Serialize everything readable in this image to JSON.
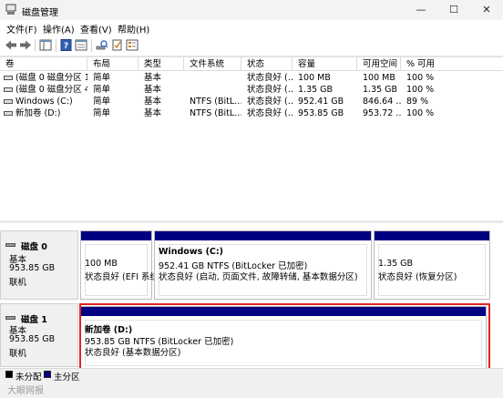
{
  "window": {
    "title": "磁盘管理",
    "controls": {
      "minimize": "—",
      "maximize": "☐",
      "close": "✕"
    }
  },
  "menu": [
    "文件(F)",
    "操作(A)",
    "查看(V)",
    "帮助(H)"
  ],
  "toolbar": {
    "icons": [
      "back-arrow-icon",
      "forward-arrow-icon",
      "console-tree-icon",
      "help-icon",
      "properties-icon",
      "search-drive-icon",
      "checklist-icon",
      "list-view-icon"
    ]
  },
  "table": {
    "headers": [
      "卷",
      "布局",
      "类型",
      "文件系统",
      "状态",
      "容量",
      "可用空间",
      "% 可用"
    ],
    "rows": [
      [
        "(磁盘 0 磁盘分区 1)",
        "简单",
        "基本",
        "",
        "状态良好 (…",
        "100 MB",
        "100 MB",
        "100 %"
      ],
      [
        "(磁盘 0 磁盘分区 4)",
        "简单",
        "基本",
        "",
        "状态良好 (…",
        "1.35 GB",
        "1.35 GB",
        "100 %"
      ],
      [
        "Windows (C:)",
        "简单",
        "基本",
        "NTFS (BitL…",
        "状态良好 (…",
        "952.41 GB",
        "846.64 …",
        "89 %"
      ],
      [
        "新加卷 (D:)",
        "简单",
        "基本",
        "NTFS (BitL…",
        "状态良好 (…",
        "953.85 GB",
        "953.72 …",
        "100 %"
      ]
    ]
  },
  "disks": [
    {
      "name": "磁盘 0",
      "type": "基本",
      "size": "953.85 GB",
      "status": "联机",
      "partitions": [
        {
          "title": "",
          "line1": "100 MB",
          "line2": "状态良好 (EFI 系统"
        },
        {
          "title": "Windows  (C:)",
          "line1": "952.41 GB NTFS (BitLocker 已加密)",
          "line2": "状态良好 (启动, 页面文件, 故障转储, 基本数据分区)"
        },
        {
          "title": "",
          "line1": "1.35 GB",
          "line2": "状态良好 (恢复分区)"
        }
      ]
    },
    {
      "name": "磁盘 1",
      "type": "基本",
      "size": "953.85 GB",
      "status": "联机",
      "partitions": [
        {
          "title": "新加卷  (D:)",
          "line1": "953.85 GB NTFS (BitLocker 已加密)",
          "line2": "状态良好 (基本数据分区)"
        }
      ]
    }
  ],
  "legend": [
    {
      "label": "未分配",
      "color": "#000000"
    },
    {
      "label": "主分区",
      "color": "#000082"
    }
  ],
  "watermark": "大眼网报",
  "colors": {
    "partition_bar": "#000082",
    "highlight": "#e02424"
  }
}
